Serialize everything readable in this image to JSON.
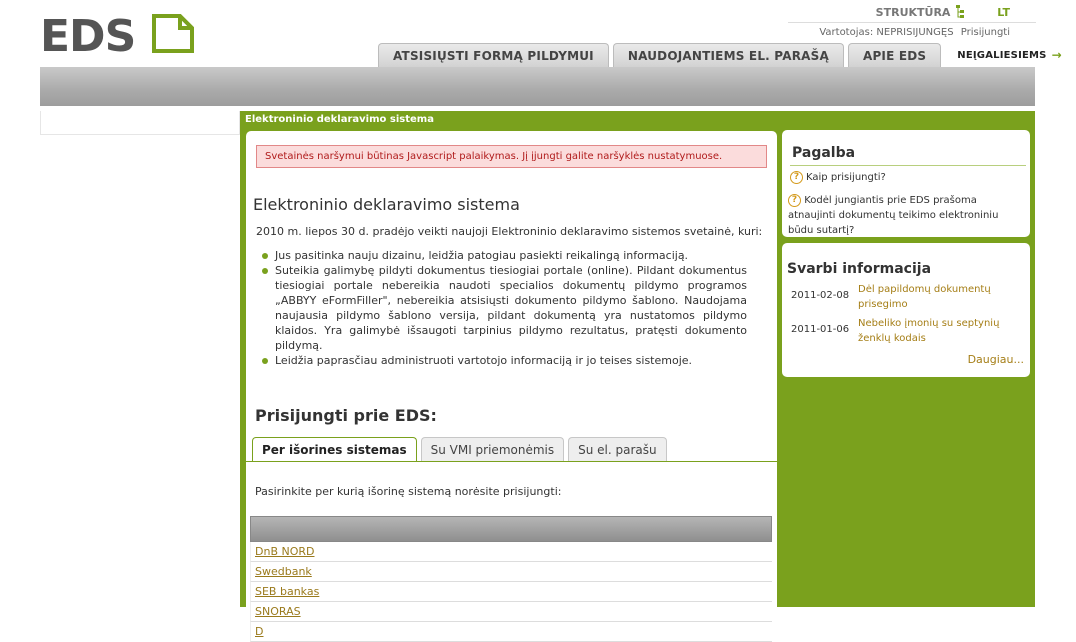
{
  "header": {
    "logo_text": "EDS",
    "structure_label": "STRUKTŪRA",
    "language": "LT",
    "user_label": "Vartotojas: NEPRISIJUNGĘS",
    "login_link": "Prisijungti",
    "tabs": [
      {
        "label": "ATSISIŲSTI FORMĄ PILDYMUI"
      },
      {
        "label": "NAUDOJANTIEMS EL. PARAŠĄ"
      },
      {
        "label": "APIE EDS"
      },
      {
        "label": "NEĮGALIESIEMS"
      }
    ]
  },
  "page": {
    "section_title": "Elektroninio deklaravimo sistema",
    "alert": "Svetainės naršymui būtinas Javascript palaikymas. Jį įjungti galite naršyklės nustatymuose.",
    "heading": "Elektroninio deklaravimo sistema",
    "intro": "2010 m. liepos 30 d. pradėjo veikti naujoji Elektroninio deklaravimo sistemos svetainė, kuri:",
    "bullets": [
      "Jus pasitinka nauju dizainu, leidžia patogiau pasiekti reikalingą informaciją.",
      "Suteikia galimybę pildyti dokumentus tiesiogiai portale (online). Pildant dokumentus tiesiogiai portale nebereikia naudoti specialios dokumentų pildymo programos „ABBYY eFormFiller\", nebereikia atsisiųsti dokumento pildymo šablono. Naudojama naujausia pildymo šablono versija, pildant dokumentą yra nustatomos pildymo klaidos. Yra galimybė išsaugoti tarpinius pildymo rezultatus, pratęsti dokumento pildymą.",
      "Leidžia paprasčiau administruoti vartotojo informaciją ir jo teises sistemoje."
    ],
    "login_heading": "Prisijungti prie EDS:",
    "login_tabs": [
      {
        "label": "Per išorines sistemas"
      },
      {
        "label": "Su VMI priemonėmis"
      },
      {
        "label": "Su el. parašu"
      }
    ],
    "choose_text": "Pasirinkite per kurią išorinę sistemą norėsite prisijungti:",
    "banks": [
      "DnB NORD",
      "Swedbank",
      "SEB bankas",
      "SNORAS",
      "D"
    ]
  },
  "help": {
    "title": "Pagalba",
    "items": [
      "Kaip prisijungti?",
      "Kodėl jungiantis prie EDS prašoma atnaujinti dokumentų teikimo elektroniniu būdu sutartį?"
    ]
  },
  "info": {
    "title": "Svarbi informacija",
    "items": [
      {
        "date": "2011-02-08",
        "text": "Dėl papildomų dokumentų prisegimo"
      },
      {
        "date": "2011-01-06",
        "text": "Nebeliko įmonių su septynių ženklų kodais"
      }
    ],
    "more": "Daugiau..."
  },
  "colors": {
    "accent": "#7aa11d",
    "link": "#a57e16",
    "alert_bg": "#fbdcdc",
    "alert_text": "#b01b1b"
  }
}
